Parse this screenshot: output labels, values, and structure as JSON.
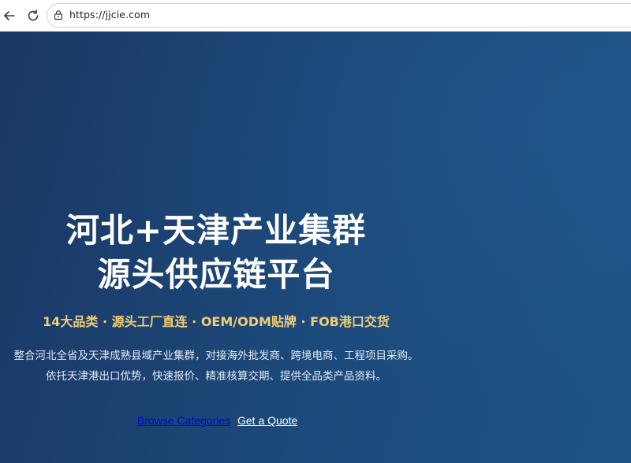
{
  "browser": {
    "url": "https://jjcie.com",
    "back_icon": "arrow-left-icon",
    "reload_icon": "reload-icon",
    "lock_icon": "lock-icon"
  },
  "hero": {
    "title_line_1": "河北+天津产业集群",
    "title_line_2": "源头供应链平台",
    "tagline": "14大品类 · 源头工厂直连 · OEM/ODM贴牌 · FOB港口交货",
    "description_line_1": "整合河北全省及天津成熟县域产业集群，对接海外批发商、跨境电商、工程项目采购。",
    "description_line_2": "依托天津港出口优势，快速报价、精准核算交期、提供全品类产品资料。",
    "browse_label": "Browse Categories",
    "quote_label": "Get a Quote",
    "colors": {
      "background_start": "#1a3764",
      "background_end": "#1c5485",
      "tagline": "#f2cd73",
      "link_blue": "#0000ee"
    }
  }
}
